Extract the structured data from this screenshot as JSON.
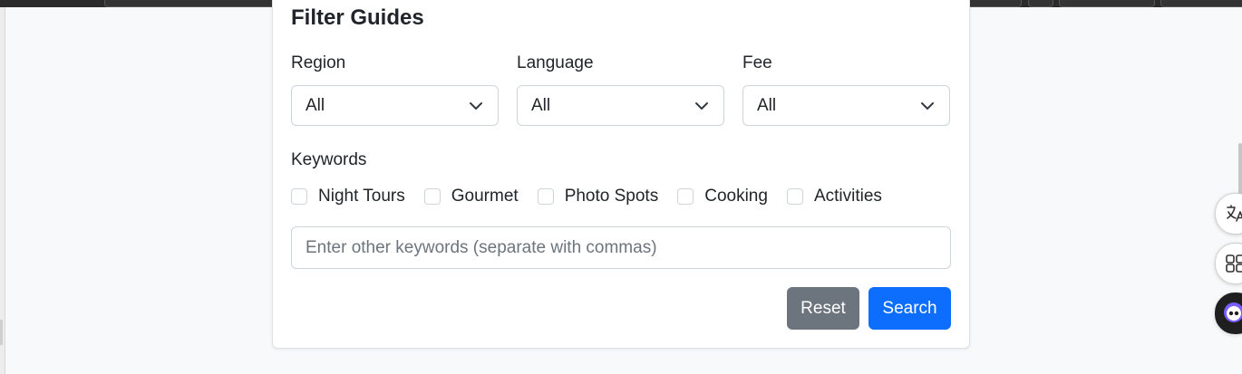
{
  "form": {
    "title": "Filter Guides",
    "region": {
      "label": "Region",
      "value": "All"
    },
    "language": {
      "label": "Language",
      "value": "All"
    },
    "fee": {
      "label": "Fee",
      "value": "All"
    },
    "keywords_label": "Keywords",
    "keywords": [
      "Night Tours",
      "Gourmet",
      "Photo Spots",
      "Cooking",
      "Activities"
    ],
    "keywords_placeholder": "Enter other keywords (separate with commas)",
    "reset_label": "Reset",
    "search_label": "Search"
  },
  "side_buttons": [
    "translate-icon",
    "apps-grid-icon",
    "assistant-avatar-icon"
  ],
  "colors": {
    "primary": "#0d6efd",
    "secondary": "#6c757d",
    "border": "#ced4da",
    "background": "#f8f9fa"
  }
}
